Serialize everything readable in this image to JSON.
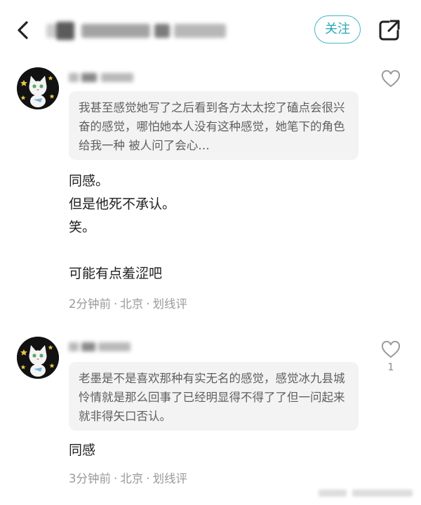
{
  "header": {
    "follow_label": "关注"
  },
  "comments": [
    {
      "quote": "我甚至感觉她写了之后看到各方太太挖了磕点会很兴奋的感觉，哪怕她本人没有这种感觉，她笔下的角色给我一种 被人问了会心…",
      "lines": [
        "同感。",
        "但是他死不承认。",
        "笑。",
        "",
        "可能有点羞涩吧"
      ],
      "time": "2分钟前",
      "location": "北京",
      "reply_label": "划线评",
      "likes": ""
    },
    {
      "quote": "老墨是不是喜欢那种有实无名的感觉，感觉冰九县城怜情就是那么回事了已经明显得不得了了但一问起来就非得矢口否认。",
      "lines": [
        "同感"
      ],
      "time": "3分钟前",
      "location": "北京",
      "reply_label": "划线评",
      "likes": "1"
    }
  ],
  "icons": {
    "back": "chevron-left-icon",
    "share": "share-external-icon",
    "like": "heart-outline-icon"
  },
  "colors": {
    "accent": "#3fb8c6",
    "quote_bg": "#f3f3f3",
    "meta_text": "#999999"
  }
}
